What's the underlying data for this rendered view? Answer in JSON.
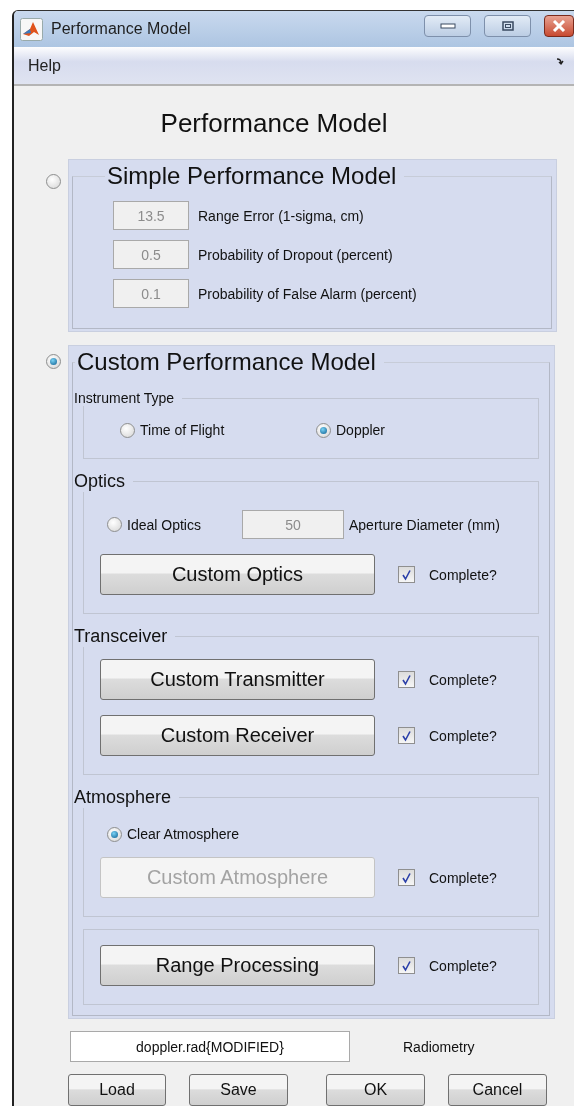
{
  "window": {
    "title": "Performance Model"
  },
  "menu": [
    "Help"
  ],
  "heading": "Performance Model",
  "simple_model": {
    "title": "Simple Performance Model",
    "selected": false,
    "fields": [
      {
        "value": "13.5",
        "label": "Range Error (1-sigma, cm)",
        "disabled": true
      },
      {
        "value": "0.5",
        "label": "Probability of Dropout (percent)",
        "disabled": true
      },
      {
        "value": "0.1",
        "label": "Probability of False Alarm (percent)",
        "disabled": true
      }
    ]
  },
  "custom_model": {
    "title": "Custom Performance Model",
    "selected": true,
    "sections": [
      {
        "kind": "compact",
        "title": "Instrument Type",
        "rows": [
          {
            "kind": "radios",
            "options": [
              {
                "label": "Time of Flight",
                "selected": false
              },
              {
                "label": "Doppler",
                "selected": true
              }
            ]
          }
        ]
      },
      {
        "kind": "normal",
        "title": "Optics",
        "rows": [
          {
            "kind": "radio-field",
            "label": "Ideal Optics",
            "selected": false,
            "value": "50",
            "disabled": true,
            "field_label": "Aperture Diameter (mm)"
          },
          {
            "kind": "button-check",
            "button": "Custom Optics",
            "disabled": false,
            "checked": true,
            "check_label": "Complete?"
          }
        ]
      },
      {
        "kind": "normal",
        "title": "Transceiver",
        "rows": [
          {
            "kind": "button-check",
            "button": "Custom Transmitter",
            "disabled": false,
            "checked": true,
            "check_label": "Complete?"
          },
          {
            "kind": "button-check",
            "button": "Custom Receiver",
            "disabled": false,
            "checked": true,
            "check_label": "Complete?"
          }
        ]
      },
      {
        "kind": "normal",
        "title": "Atmosphere",
        "rows": [
          {
            "kind": "radio",
            "label": "Clear Atmosphere",
            "selected": true
          },
          {
            "kind": "button-check",
            "button": "Custom Atmosphere",
            "disabled": true,
            "checked": true,
            "check_label": "Complete?"
          }
        ]
      },
      {
        "kind": "normal",
        "rows": [
          {
            "kind": "button-check",
            "button": "Range Processing",
            "disabled": false,
            "checked": true,
            "check_label": "Complete?"
          }
        ]
      }
    ]
  },
  "file": {
    "value": "doppler.rad{MODIFIED}",
    "label": "Radiometry"
  },
  "buttons": [
    "Load",
    "Save",
    "OK",
    "Cancel"
  ]
}
